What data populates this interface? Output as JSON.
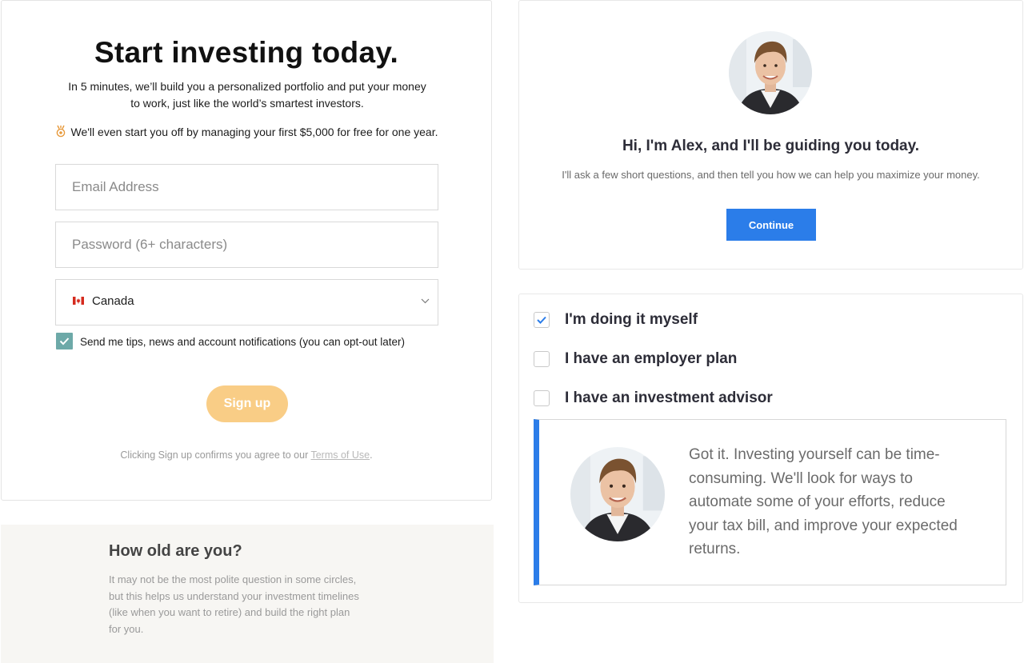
{
  "signup": {
    "title": "Start investing today.",
    "subtitle": "In 5 minutes, we’ll build you a personalized portfolio and put your money to work, just like the world’s smartest investors.",
    "free_offer": "We'll even start you off by managing your first $5,000 for free for one year.",
    "email_placeholder": "Email Address",
    "password_placeholder": "Password (6+ characters)",
    "country": "Canada",
    "tips_label": "Send me tips, news and account notifications (you can opt-out later)",
    "tips_checked": true,
    "signup_button": "Sign up",
    "terms_prefix": "Clicking Sign up confirms you agree to our ",
    "terms_link": "Terms of Use",
    "terms_suffix": "."
  },
  "age": {
    "title": "How old are you?",
    "body": "It may not be the most polite question in some circles, but this helps us understand your investment timelines (like when you want to retire) and build the right plan for you."
  },
  "alex": {
    "title": "Hi, I'm Alex, and I'll be guiding you today.",
    "subtitle": "I'll ask a few short questions, and then tell you how we can help you maximize your money.",
    "continue_button": "Continue"
  },
  "options": {
    "items": [
      {
        "label": "I'm doing it myself",
        "checked": true
      },
      {
        "label": "I have an employer plan",
        "checked": false
      },
      {
        "label": "I have an investment advisor",
        "checked": false
      }
    ],
    "message": "Got it. Investing yourself can be time-consuming. We'll look for ways to automate some of your efforts, reduce your tax bill, and improve your expected returns."
  },
  "colors": {
    "accent_blue": "#2b7de9",
    "signup_button": "#f9cd86",
    "checkbox_teal": "#6da9a8"
  },
  "icons": [
    "medal-icon",
    "canada-flag-icon",
    "chevron-down-icon",
    "checkmark-icon",
    "advisor-avatar"
  ]
}
